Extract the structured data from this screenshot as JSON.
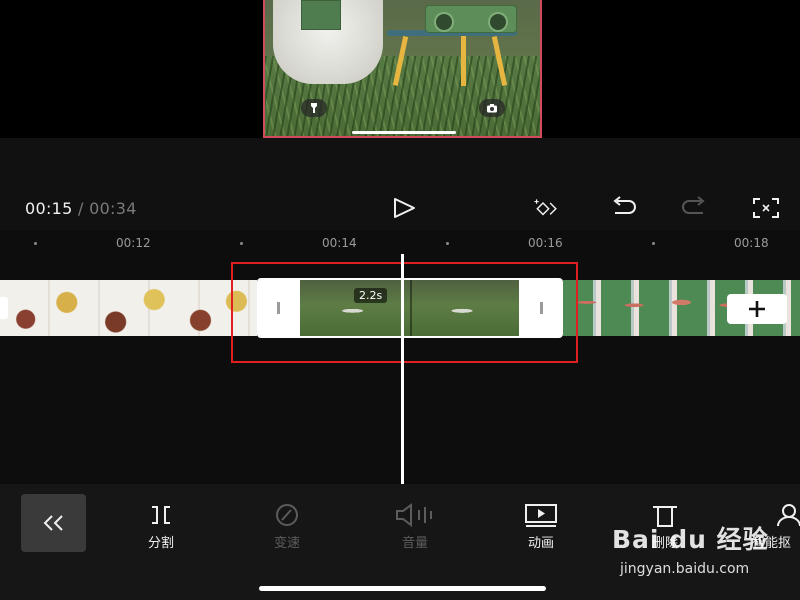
{
  "player": {
    "current_time": "00:15",
    "separator": "/",
    "total_time": "00:34"
  },
  "timeline": {
    "ticks": [
      "00:12",
      "00:14",
      "00:16",
      "00:18"
    ]
  },
  "clip": {
    "duration": "2.2s"
  },
  "tools": {
    "split": "分割",
    "speed": "变速",
    "volume": "音量",
    "animation": "动画",
    "delete": "删除",
    "smart": "智能抠"
  },
  "watermark": {
    "logo": "Bai du 经验",
    "url": "jingyan.baidu.com"
  },
  "colors": {
    "highlight": "#e02020",
    "frame_border": "#d24a5c"
  },
  "icons": {
    "flashlight": "flashlight-icon",
    "camera": "camera-icon",
    "play": "play-icon",
    "keyframe": "keyframe-icon",
    "undo": "undo-icon",
    "redo": "redo-icon",
    "fullscreen": "fullscreen-icon",
    "add": "plus-icon",
    "collapse": "double-chevron-left-icon"
  }
}
